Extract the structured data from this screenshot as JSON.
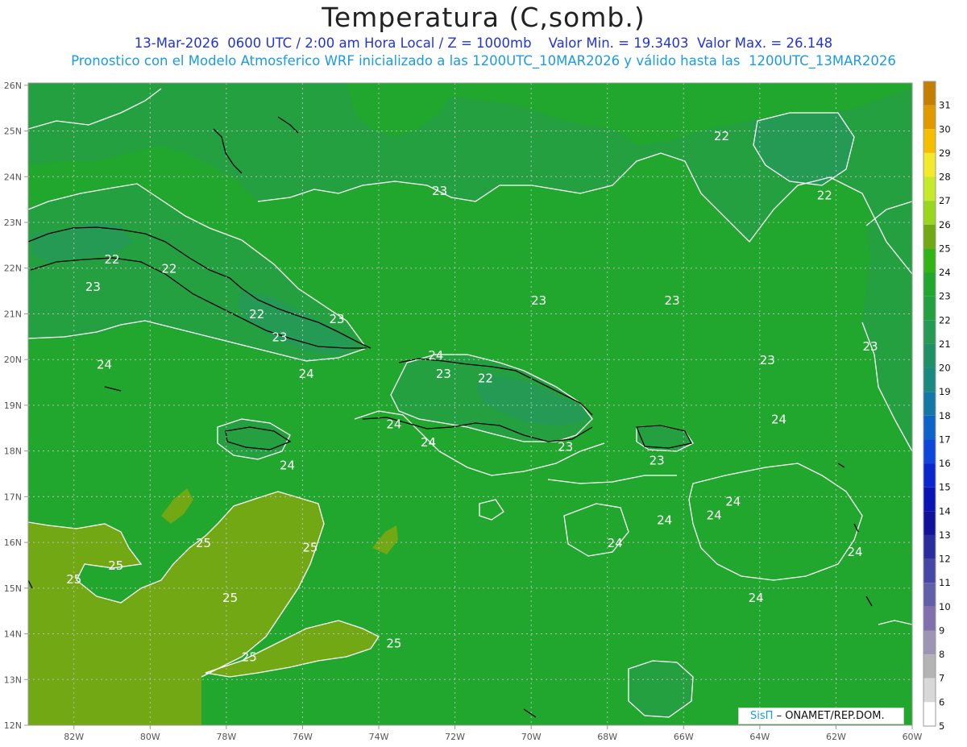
{
  "header": {
    "title": "Temperatura (C,somb.)",
    "line1": "13-Mar-2026  0600 UTC / 2:00 am Hora Local / Z = 1000mb    Valor Min. = 19.3403  Valor Max. = 26.148",
    "line2": "Pronostico con el Modelo Atmosferico WRF inicializado a las 1200UTC_10MAR2026 y válido hasta las  1200UTC_13MAR2026"
  },
  "map": {
    "lat_labels": [
      "26N",
      "25N",
      "24N",
      "23N",
      "22N",
      "21N",
      "20N",
      "19N",
      "18N",
      "17N",
      "16N",
      "15N",
      "14N",
      "13N",
      "12N"
    ],
    "lon_labels": [
      "82W",
      "80W",
      "78W",
      "76W",
      "74W",
      "72W",
      "70W",
      "68W",
      "66W",
      "64W",
      "62W",
      "60W"
    ],
    "contour_labels": [
      {
        "text": "22",
        "lon": -65.0,
        "lat": 24.8
      },
      {
        "text": "22",
        "lon": -62.3,
        "lat": 23.5
      },
      {
        "text": "23",
        "lon": -72.4,
        "lat": 23.6
      },
      {
        "text": "22",
        "lon": -81.0,
        "lat": 22.1
      },
      {
        "text": "22",
        "lon": -79.5,
        "lat": 21.9
      },
      {
        "text": "23",
        "lon": -81.5,
        "lat": 21.5
      },
      {
        "text": "22",
        "lon": -77.2,
        "lat": 20.9
      },
      {
        "text": "23",
        "lon": -75.1,
        "lat": 20.8
      },
      {
        "text": "23",
        "lon": -76.6,
        "lat": 20.4
      },
      {
        "text": "24",
        "lon": -81.2,
        "lat": 19.8
      },
      {
        "text": "24",
        "lon": -75.9,
        "lat": 19.6
      },
      {
        "text": "24",
        "lon": -72.5,
        "lat": 20.0
      },
      {
        "text": "23",
        "lon": -72.3,
        "lat": 19.6
      },
      {
        "text": "22",
        "lon": -71.2,
        "lat": 19.5
      },
      {
        "text": "23",
        "lon": -69.8,
        "lat": 21.2
      },
      {
        "text": "23",
        "lon": -66.3,
        "lat": 21.2
      },
      {
        "text": "23",
        "lon": -63.8,
        "lat": 19.9
      },
      {
        "text": "23",
        "lon": -61.1,
        "lat": 20.2
      },
      {
        "text": "24",
        "lon": -73.6,
        "lat": 18.5
      },
      {
        "text": "24",
        "lon": -72.7,
        "lat": 18.1
      },
      {
        "text": "23",
        "lon": -69.1,
        "lat": 18.0
      },
      {
        "text": "24",
        "lon": -76.4,
        "lat": 17.6
      },
      {
        "text": "23",
        "lon": -66.7,
        "lat": 17.7
      },
      {
        "text": "24",
        "lon": -63.5,
        "lat": 18.6
      },
      {
        "text": "24",
        "lon": -66.5,
        "lat": 16.4
      },
      {
        "text": "24",
        "lon": -65.2,
        "lat": 16.5
      },
      {
        "text": "24",
        "lon": -64.7,
        "lat": 16.8
      },
      {
        "text": "24",
        "lon": -67.8,
        "lat": 15.9
      },
      {
        "text": "25",
        "lon": -78.6,
        "lat": 15.9
      },
      {
        "text": "25",
        "lon": -80.9,
        "lat": 15.4
      },
      {
        "text": "25",
        "lon": -75.8,
        "lat": 15.8
      },
      {
        "text": "25",
        "lon": -82.0,
        "lat": 15.1
      },
      {
        "text": "25",
        "lon": -77.9,
        "lat": 14.7
      },
      {
        "text": "24",
        "lon": -64.1,
        "lat": 14.7
      },
      {
        "text": "24",
        "lon": -61.5,
        "lat": 15.7
      },
      {
        "text": "25",
        "lon": -73.6,
        "lat": 13.7
      },
      {
        "text": "25",
        "lon": -77.4,
        "lat": 13.4
      }
    ]
  },
  "colorbar": {
    "levels": [
      "31",
      "30",
      "29",
      "28",
      "27",
      "26",
      "25",
      "24",
      "23",
      "22",
      "21",
      "20",
      "19",
      "18",
      "17",
      "16",
      "15",
      "14",
      "13",
      "12",
      "11",
      "10",
      "9",
      "8",
      "7",
      "6",
      "5"
    ],
    "colors": [
      "#c47e00",
      "#e09a00",
      "#f5be00",
      "#f2ea2a",
      "#c4ea2a",
      "#9ad61e",
      "#72a814",
      "#32b414",
      "#21a62e",
      "#24a040",
      "#259a55",
      "#209066",
      "#1a8a80",
      "#1478a6",
      "#0d64c8",
      "#0d46d8",
      "#0a26cc",
      "#0a14b4",
      "#10129c",
      "#2a2c9e",
      "#4646a6",
      "#6060aa",
      "#8070ae",
      "#9e94b4",
      "#b4b4b4",
      "#d8d8d8",
      "#ffffff"
    ]
  },
  "credit": {
    "brand": "SisΠ",
    "org": "– ONAMET/REP.DOM."
  }
}
